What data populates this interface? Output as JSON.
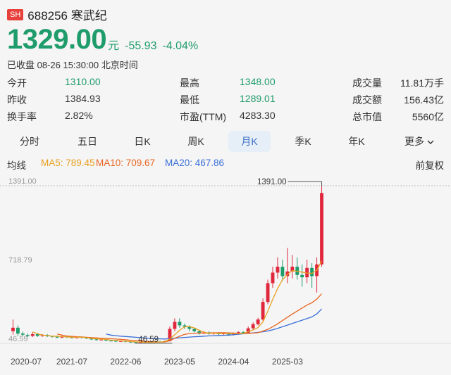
{
  "header": {
    "exchange_badge": "SH",
    "stock_title": "688256 寒武纪",
    "price": "1329.00",
    "price_unit": "元",
    "change": "-55.93",
    "change_pct": "-4.04%",
    "status": "已收盘 08-26 15:30:00 北京时间"
  },
  "stats": [
    {
      "label": "今开",
      "value": "1310.00"
    },
    {
      "label": "昨收",
      "value": "1384.93"
    },
    {
      "label": "换手率",
      "value": "2.82%"
    },
    {
      "label": "最高",
      "value": "1348.00"
    },
    {
      "label": "最低",
      "value": "1289.01"
    },
    {
      "label": "市盈(TTM)",
      "value": "4283.30"
    },
    {
      "label": "成交量",
      "value": "11.81万手"
    },
    {
      "label": "成交额",
      "value": "156.43亿"
    },
    {
      "label": "总市值",
      "value": "5560亿"
    }
  ],
  "tabs": [
    {
      "label": "分时",
      "active": false
    },
    {
      "label": "五日",
      "active": false
    },
    {
      "label": "日K",
      "active": false
    },
    {
      "label": "周K",
      "active": false
    },
    {
      "label": "月K",
      "active": true
    },
    {
      "label": "季K",
      "active": false
    },
    {
      "label": "年K",
      "active": false
    },
    {
      "label": "更多",
      "active": false
    }
  ],
  "ma_bar": {
    "label": "均线",
    "ma5": "MA5: 789.45",
    "ma10": "MA10: 709.67",
    "ma20": "MA20: 467.86",
    "adjust": "前复权"
  },
  "colors": {
    "up": "#e0283c",
    "down": "#1f9c6b",
    "ma5": "#e8a020",
    "ma10": "#e86420",
    "ma20": "#3a6fd8",
    "accent": "#3a6fc4"
  },
  "chart_data": {
    "type": "candlestick",
    "period": "monthly",
    "y_labels": [
      "1391.00",
      "718.79",
      "46.59"
    ],
    "ylim": [
      46.59,
      1391.0
    ],
    "x_labels": [
      "2020-07",
      "2021-07",
      "2022-06",
      "2023-05",
      "2024-04",
      "2025-03"
    ],
    "max_annotation": "1391.00",
    "min_annotation": "46.59",
    "candles": [
      {
        "o": 150,
        "c": 180,
        "h": 250,
        "l": 120
      },
      {
        "o": 180,
        "c": 130,
        "h": 200,
        "l": 110
      },
      {
        "o": 130,
        "c": 120,
        "h": 145,
        "l": 105
      },
      {
        "o": 118,
        "c": 110,
        "h": 130,
        "l": 100
      },
      {
        "o": 110,
        "c": 125,
        "h": 140,
        "l": 100
      },
      {
        "o": 125,
        "c": 110,
        "h": 135,
        "l": 102
      },
      {
        "o": 110,
        "c": 118,
        "h": 125,
        "l": 102
      },
      {
        "o": 118,
        "c": 108,
        "h": 125,
        "l": 100
      },
      {
        "o": 108,
        "c": 102,
        "h": 112,
        "l": 95
      },
      {
        "o": 102,
        "c": 96,
        "h": 108,
        "l": 90
      },
      {
        "o": 96,
        "c": 105,
        "h": 112,
        "l": 90
      },
      {
        "o": 105,
        "c": 98,
        "h": 110,
        "l": 92
      },
      {
        "o": 98,
        "c": 92,
        "h": 104,
        "l": 88
      },
      {
        "o": 92,
        "c": 100,
        "h": 106,
        "l": 88
      },
      {
        "o": 100,
        "c": 95,
        "h": 105,
        "l": 88
      },
      {
        "o": 95,
        "c": 88,
        "h": 100,
        "l": 84
      },
      {
        "o": 88,
        "c": 80,
        "h": 94,
        "l": 75
      },
      {
        "o": 80,
        "c": 74,
        "h": 85,
        "l": 70
      },
      {
        "o": 74,
        "c": 78,
        "h": 85,
        "l": 70
      },
      {
        "o": 78,
        "c": 70,
        "h": 82,
        "l": 66
      },
      {
        "o": 70,
        "c": 68,
        "h": 75,
        "l": 62
      },
      {
        "o": 68,
        "c": 62,
        "h": 72,
        "l": 58
      },
      {
        "o": 62,
        "c": 66,
        "h": 70,
        "l": 58
      },
      {
        "o": 66,
        "c": 60,
        "h": 70,
        "l": 55
      },
      {
        "o": 60,
        "c": 56,
        "h": 64,
        "l": 52
      },
      {
        "o": 56,
        "c": 52,
        "h": 60,
        "l": 47
      },
      {
        "o": 52,
        "c": 56,
        "h": 60,
        "l": 48
      },
      {
        "o": 56,
        "c": 58,
        "h": 62,
        "l": 50
      },
      {
        "o": 58,
        "c": 54,
        "h": 62,
        "l": 48
      },
      {
        "o": 54,
        "c": 62,
        "h": 66,
        "l": 50
      },
      {
        "o": 62,
        "c": 60,
        "h": 68,
        "l": 55
      },
      {
        "o": 60,
        "c": 66,
        "h": 70,
        "l": 55
      },
      {
        "o": 66,
        "c": 170,
        "h": 190,
        "l": 62
      },
      {
        "o": 170,
        "c": 230,
        "h": 260,
        "l": 150
      },
      {
        "o": 230,
        "c": 200,
        "h": 260,
        "l": 180
      },
      {
        "o": 200,
        "c": 190,
        "h": 215,
        "l": 170
      },
      {
        "o": 190,
        "c": 170,
        "h": 200,
        "l": 150
      },
      {
        "o": 170,
        "c": 150,
        "h": 180,
        "l": 140
      },
      {
        "o": 150,
        "c": 130,
        "h": 160,
        "l": 120
      },
      {
        "o": 130,
        "c": 140,
        "h": 150,
        "l": 125
      },
      {
        "o": 140,
        "c": 128,
        "h": 150,
        "l": 120
      },
      {
        "o": 128,
        "c": 135,
        "h": 142,
        "l": 120
      },
      {
        "o": 135,
        "c": 125,
        "h": 140,
        "l": 115
      },
      {
        "o": 125,
        "c": 132,
        "h": 140,
        "l": 118
      },
      {
        "o": 132,
        "c": 122,
        "h": 138,
        "l": 110
      },
      {
        "o": 122,
        "c": 130,
        "h": 138,
        "l": 115
      },
      {
        "o": 130,
        "c": 142,
        "h": 150,
        "l": 120
      },
      {
        "o": 142,
        "c": 135,
        "h": 150,
        "l": 125
      },
      {
        "o": 135,
        "c": 175,
        "h": 190,
        "l": 130
      },
      {
        "o": 175,
        "c": 210,
        "h": 225,
        "l": 165
      },
      {
        "o": 210,
        "c": 250,
        "h": 265,
        "l": 200
      },
      {
        "o": 250,
        "c": 400,
        "h": 430,
        "l": 240
      },
      {
        "o": 400,
        "c": 560,
        "h": 590,
        "l": 380
      },
      {
        "o": 560,
        "c": 650,
        "h": 700,
        "l": 520
      },
      {
        "o": 650,
        "c": 700,
        "h": 780,
        "l": 600
      },
      {
        "o": 700,
        "c": 620,
        "h": 760,
        "l": 580
      },
      {
        "o": 620,
        "c": 660,
        "h": 860,
        "l": 560
      },
      {
        "o": 660,
        "c": 700,
        "h": 800,
        "l": 600
      },
      {
        "o": 700,
        "c": 630,
        "h": 780,
        "l": 590
      },
      {
        "o": 630,
        "c": 610,
        "h": 720,
        "l": 530
      },
      {
        "o": 610,
        "c": 690,
        "h": 760,
        "l": 560
      },
      {
        "o": 690,
        "c": 620,
        "h": 730,
        "l": 520
      },
      {
        "o": 620,
        "c": 720,
        "h": 780,
        "l": 480
      },
      {
        "o": 720,
        "c": 1329,
        "h": 1391,
        "l": 700
      }
    ],
    "ma5": [
      null,
      null,
      null,
      null,
      144,
      129,
      117,
      113,
      108,
      108,
      104,
      101,
      99,
      98,
      98,
      95,
      89,
      85,
      83,
      80,
      74,
      71,
      68,
      66,
      62,
      59,
      58,
      57,
      55,
      57,
      58,
      60,
      84,
      120,
      158,
      187,
      190,
      178,
      158,
      141,
      133,
      132,
      132,
      131,
      130,
      130,
      130,
      132,
      145,
      161,
      181,
      230,
      320,
      422,
      513,
      590,
      634,
      668,
      662,
      654,
      646,
      644,
      670,
      750
    ],
    "ma10": [
      null,
      null,
      null,
      null,
      null,
      null,
      null,
      null,
      null,
      126,
      117,
      109,
      106,
      103,
      101,
      98,
      95,
      93,
      90,
      88,
      86,
      83,
      80,
      77,
      73,
      70,
      67,
      64,
      61,
      60,
      58,
      58,
      70,
      90,
      107,
      123,
      130,
      133,
      134,
      135,
      136,
      136,
      137,
      137,
      136,
      134,
      132,
      130,
      131,
      134,
      137,
      151,
      166,
      188,
      213,
      241,
      270,
      296,
      322,
      348,
      373,
      393,
      424,
      470
    ],
    "ma20": [
      null,
      null,
      null,
      null,
      null,
      null,
      null,
      null,
      null,
      null,
      null,
      null,
      null,
      null,
      null,
      null,
      null,
      null,
      null,
      126,
      117,
      112,
      108,
      105,
      102,
      98,
      95,
      92,
      89,
      87,
      85,
      84,
      86,
      90,
      94,
      97,
      100,
      103,
      105,
      108,
      110,
      112,
      114,
      115,
      117,
      120,
      124,
      128,
      132,
      136,
      140,
      145,
      152,
      162,
      174,
      188,
      202,
      216,
      230,
      244,
      258,
      272,
      298,
      340
    ]
  }
}
